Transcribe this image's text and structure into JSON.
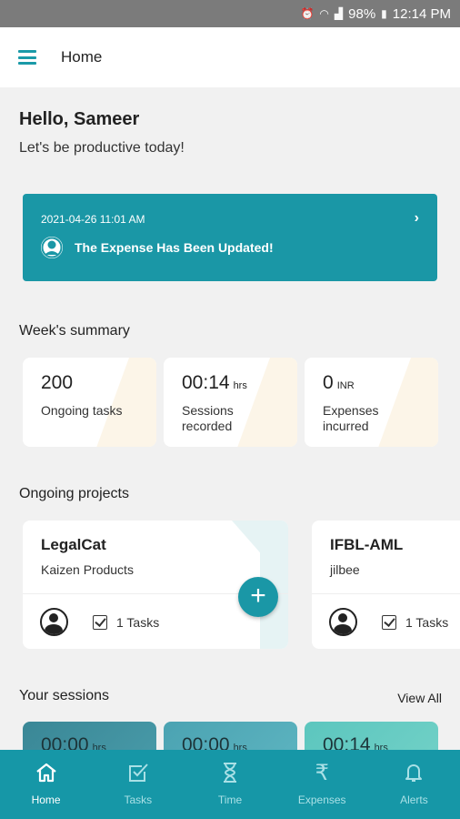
{
  "status_bar": {
    "battery": "98%",
    "time": "12:14 PM"
  },
  "app_bar": {
    "title": "Home",
    "menu_icon": "hamburger-menu-icon"
  },
  "greeting": {
    "title": "Hello, Sameer",
    "subtitle": "Let's be productive today!"
  },
  "notification": {
    "timestamp": "2021-04-26 11:01 AM",
    "message": "The Expense Has Been Updated!"
  },
  "week_summary": {
    "title": "Week's summary",
    "cards": [
      {
        "value": "200",
        "unit": "",
        "label": "Ongoing tasks"
      },
      {
        "value": "00:14",
        "unit": "hrs",
        "label": "Sessions recorded"
      },
      {
        "value": "0",
        "unit": "INR",
        "label": "Expenses incurred"
      }
    ]
  },
  "projects": {
    "title": "Ongoing projects",
    "items": [
      {
        "name": "LegalCat",
        "org": "Kaizen Products",
        "tasks": "1 Tasks"
      },
      {
        "name": "IFBL-AML",
        "org": "jilbee",
        "tasks": "1 Tasks"
      }
    ]
  },
  "sessions": {
    "title": "Your sessions",
    "view_all": "View All",
    "items": [
      {
        "value": "00:00",
        "unit": "hrs",
        "color": "#3e8d9c"
      },
      {
        "value": "00:00",
        "unit": "hrs",
        "color": "#4aa6b4"
      },
      {
        "value": "00:14",
        "unit": "hrs",
        "color": "#5cc7c0"
      }
    ]
  },
  "bottom_nav": [
    {
      "label": "Home",
      "icon": "home-icon",
      "active": true
    },
    {
      "label": "Tasks",
      "icon": "task-check-icon",
      "active": false
    },
    {
      "label": "Time",
      "icon": "hourglass-icon",
      "active": false
    },
    {
      "label": "Expenses",
      "icon": "rupee-icon",
      "active": false
    },
    {
      "label": "Alerts",
      "icon": "bell-icon",
      "active": false
    }
  ],
  "colors": {
    "primary": "#1697a7",
    "background": "#f1f1f1"
  }
}
